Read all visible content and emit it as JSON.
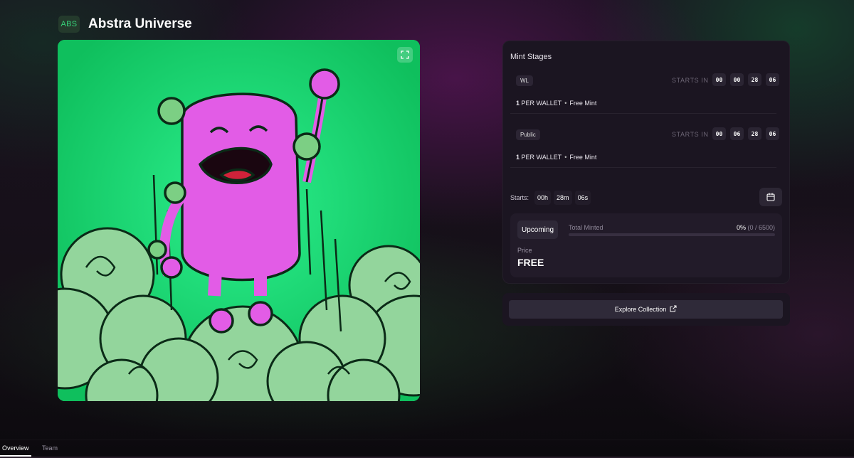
{
  "header": {
    "badge": "ABS",
    "title": "Abstra Universe"
  },
  "artwork": {
    "expand_icon": "expand-icon",
    "colors": {
      "background": "#1ee37b",
      "character": "#e25ce6",
      "smoke": "#7ccf84"
    }
  },
  "mint_stages": {
    "title": "Mint Stages",
    "stages": [
      {
        "tag": "WL",
        "starts_in_label": "STARTS IN",
        "countdown": [
          "00",
          "00",
          "28",
          "06"
        ],
        "limit": "1",
        "limit_text": "PER WALLET",
        "separator": "•",
        "type": "Free Mint"
      },
      {
        "tag": "Public",
        "starts_in_label": "STARTS IN",
        "countdown": [
          "00",
          "06",
          "28",
          "06"
        ],
        "limit": "1",
        "limit_text": "PER WALLET",
        "separator": "•",
        "type": "Free Mint"
      }
    ],
    "starts": {
      "label": "Starts:",
      "hours": "00h",
      "minutes": "28m",
      "seconds": "06s"
    },
    "calendar_icon": "calendar-icon",
    "status": {
      "button": "Upcoming",
      "total_minted_label": "Total Minted",
      "percent": "0%",
      "count": "(0 / 6500)",
      "progress_fraction": 0,
      "price_label": "Price",
      "price_value": "FREE"
    }
  },
  "explore": {
    "label": "Explore Collection",
    "icon": "external-link-icon"
  },
  "tabs": [
    {
      "label": "Overview",
      "active": true
    },
    {
      "label": "Team",
      "active": false
    }
  ],
  "colors": {
    "accent": "#36d27a",
    "panel": "#1b1521"
  }
}
